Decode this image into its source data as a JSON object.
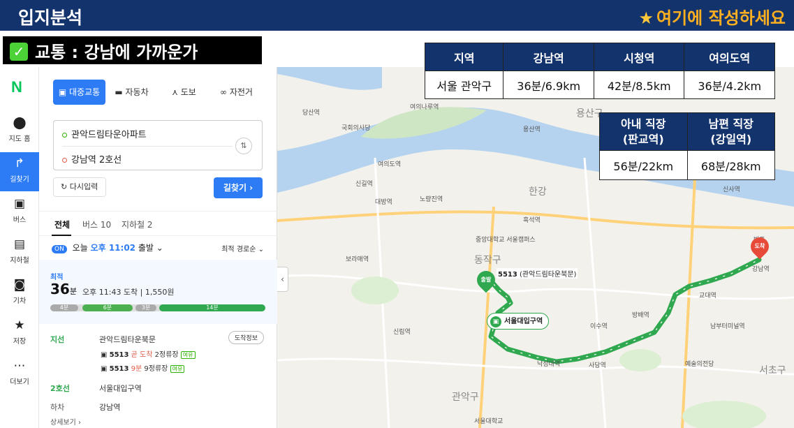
{
  "slide": {
    "title": "입지분석",
    "hint": "여기에 작성하세요",
    "section_label": "교통 : 강남에 가까운가"
  },
  "rail": {
    "logo": "N",
    "items": [
      {
        "label": "지도 홈",
        "icon": "map-pin-icon"
      },
      {
        "label": "길찾기",
        "icon": "directions-icon"
      },
      {
        "label": "버스",
        "icon": "bus-icon"
      },
      {
        "label": "지하철",
        "icon": "subway-icon"
      },
      {
        "label": "기차",
        "icon": "train-icon"
      },
      {
        "label": "저장",
        "icon": "star-icon"
      },
      {
        "label": "더보기",
        "icon": "more-icon"
      }
    ]
  },
  "directions": {
    "modes": [
      "대중교통",
      "자동차",
      "도보",
      "자전거"
    ],
    "origin": "관악드림타운아파트",
    "destination": "강남역 2호선",
    "reset_label": "다시입력",
    "search_label": "길찾기 ›",
    "tabs": [
      "전체",
      "버스 10",
      "지하철 2"
    ],
    "depart_badge": "ON",
    "depart_prefix": "오늘",
    "depart_time": "오후 11:02",
    "depart_suffix": "출발",
    "sort_label": "최적 경로순",
    "best_label": "최적",
    "duration_num": "36",
    "duration_unit": "분",
    "arrive_text": "오후 11:43 도착  |  1,550원",
    "segments": [
      "4분",
      "6분",
      "3분",
      "14분"
    ],
    "step1_tag": "지선",
    "step1_place": "관악드림타운북문",
    "arrive_info_btn": "도착정보",
    "bus1": {
      "no": "5513",
      "status": "곧 도착",
      "stops": "2정류장",
      "crowd": "여유"
    },
    "bus2": {
      "no": "5513",
      "status": "9분",
      "stops": "9정류장",
      "crowd": "여유"
    },
    "step2_tag": "2호선",
    "step2_place": "서울대입구역",
    "step3_tag": "하차",
    "step3_place": "강남역",
    "more_label": "상세보기 ›"
  },
  "map": {
    "labels": {
      "l1": "당산역",
      "l2": "국회의사당",
      "l3": "여의도역",
      "l4": "여의나루역",
      "l5": "용산구",
      "l6": "용산역",
      "l7": "신길역",
      "l8": "대방역",
      "l9": "노량진역",
      "l10": "흑석역",
      "l11": "동작구",
      "l12": "중앙대학교 서울캠퍼스",
      "l13": "보라매역",
      "l14": "신림역",
      "l15": "서울대입구역",
      "l16": "낙성대역",
      "l17": "사당역",
      "l18": "이수역",
      "l19": "방배역",
      "l20": "교대역",
      "l21": "강남역",
      "l22": "서초구",
      "l23": "예술의전당",
      "l24": "신사역",
      "l25": "반포",
      "l26": "남부터미널역",
      "l27": "관악구",
      "l28": "한강",
      "l29": "서울대학교"
    },
    "start_marker": "출발",
    "end_marker": "도착",
    "stop_name": "서울대입구역",
    "bus_note_no": "5513",
    "bus_note_stop": "(관악드림타운북문)"
  },
  "table1": {
    "headers": [
      "지역",
      "강남역",
      "시청역",
      "여의도역"
    ],
    "row": [
      "서울 관악구",
      "36분/6.9km",
      "42분/8.5km",
      "36분/4.2km"
    ]
  },
  "table2": {
    "headers": [
      "아내 직장\n(판교역)",
      "남편 직장\n(강일역)"
    ],
    "header_lines": [
      [
        "아내 직장",
        "(판교역)"
      ],
      [
        "남편 직장",
        "(강일역)"
      ]
    ],
    "row": [
      "56분/22km",
      "68분/28km"
    ]
  }
}
